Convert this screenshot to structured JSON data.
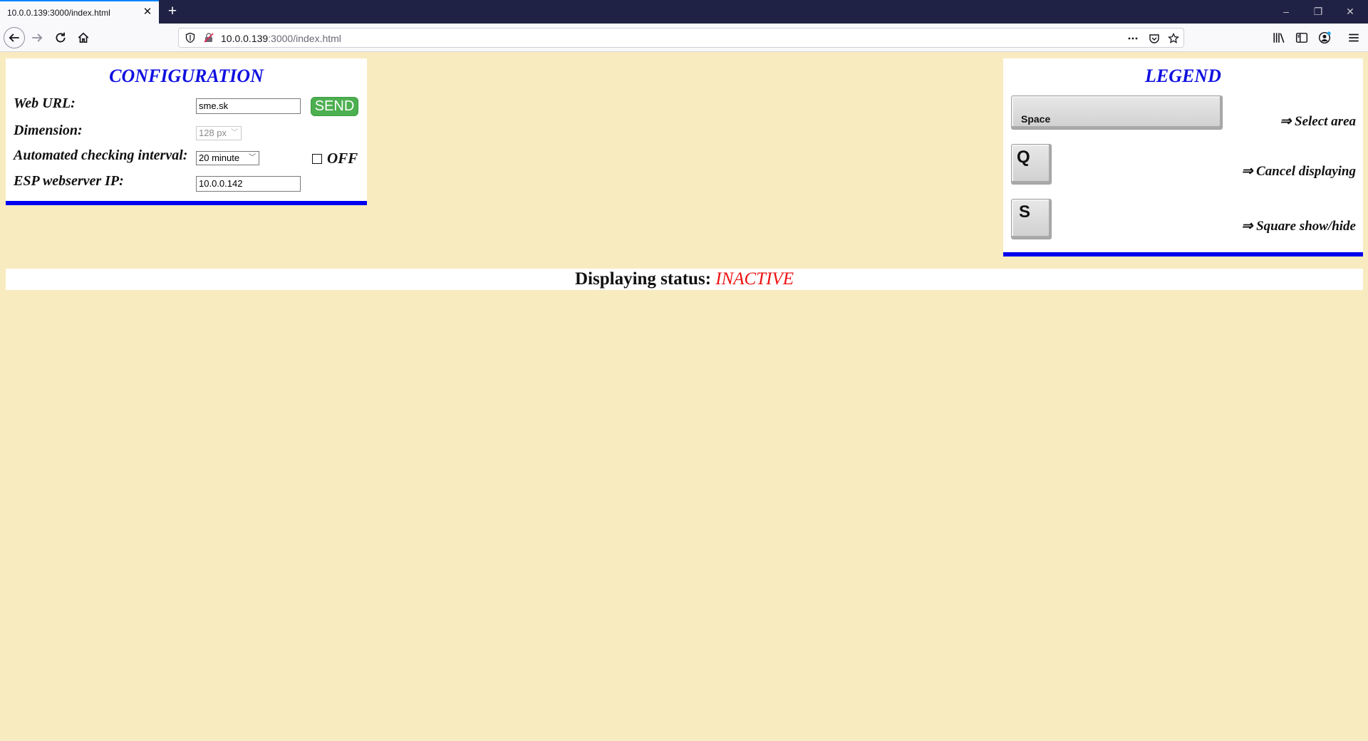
{
  "browser": {
    "tab_title": "10.0.0.139:3000/index.html",
    "tab_close": "✕",
    "new_tab": "+",
    "url_host": "10.0.0.139",
    "url_rest": ":3000/index.html",
    "window_controls": [
      "–",
      "❐",
      "✕"
    ]
  },
  "config": {
    "title": "CONFIGURATION",
    "web_url_label": "Web URL:",
    "web_url_value": "sme.sk",
    "send_label": "SEND",
    "dimension_label": "Dimension:",
    "dimension_value": "128 px",
    "interval_label": "Automated checking interval:",
    "interval_value": "20 minute",
    "checkbox_checked": false,
    "off_label": "OFF",
    "esp_label": "ESP webserver IP:",
    "esp_value": "10.0.0.142"
  },
  "legend": {
    "title": "LEGEND",
    "items": [
      {
        "key": "Space",
        "description": "⇒ Select area"
      },
      {
        "key": "Q",
        "description": "⇒ Cancel displaying"
      },
      {
        "key": "S",
        "description": "⇒ Square show/hide"
      }
    ]
  },
  "status": {
    "label": "Displaying status:",
    "value": "INACTIVE",
    "value_color": "#ee1111"
  },
  "colors": {
    "page_bg": "#f8ebbf",
    "accent_blue": "#0000ee",
    "send_green": "#4caf50"
  }
}
